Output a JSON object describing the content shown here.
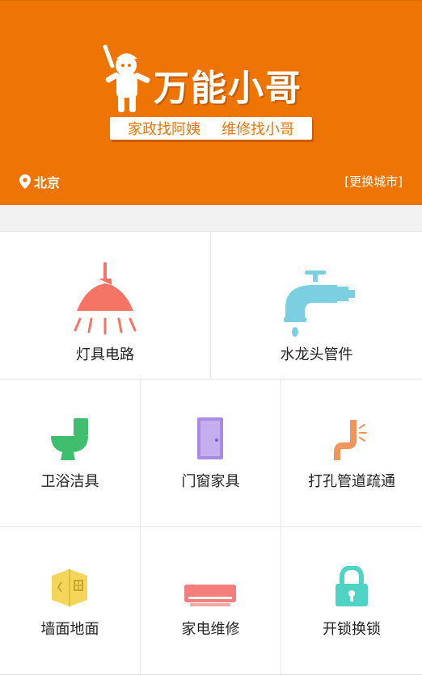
{
  "header": {
    "brand_title": "万能小哥",
    "slogan_left": "家政找阿姨",
    "slogan_right": "维修找小哥",
    "city": "北京",
    "change_city": "[更换城市]"
  },
  "services": {
    "row1": [
      {
        "label": "灯具电路",
        "icon": "lamp-icon"
      },
      {
        "label": "水龙头管件",
        "icon": "faucet-icon"
      }
    ],
    "row2": [
      {
        "label": "卫浴洁具",
        "icon": "toilet-icon"
      },
      {
        "label": "门窗家具",
        "icon": "door-icon"
      },
      {
        "label": "打孔管道疏通",
        "icon": "pipe-icon"
      }
    ],
    "row3": [
      {
        "label": "墙面地面",
        "icon": "wall-floor-icon"
      },
      {
        "label": "家电维修",
        "icon": "air-conditioner-icon"
      },
      {
        "label": "开锁换锁",
        "icon": "lock-icon"
      }
    ]
  },
  "colors": {
    "brand": "#ee7404",
    "lamp": "#f47565",
    "faucet": "#7ccfe0",
    "toilet": "#3fbf6e",
    "door": "#a98be6",
    "pipe": "#f0955c",
    "wall": "#f5d65a",
    "appliance": "#f47d7d",
    "lock": "#4fd3c4"
  }
}
